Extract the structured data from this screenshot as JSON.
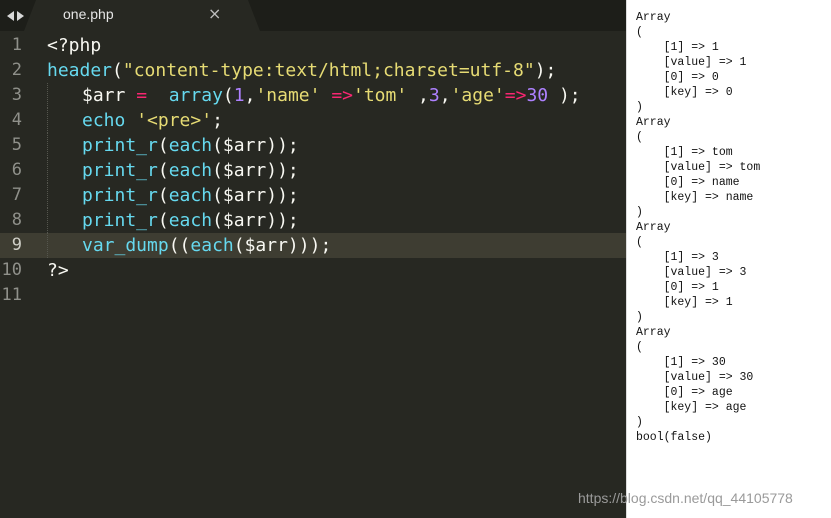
{
  "tab": {
    "title": "one.php",
    "close_glyph": "×"
  },
  "editor": {
    "line_numbers": [
      "1",
      "2",
      "3",
      "4",
      "5",
      "6",
      "7",
      "8",
      "9",
      "10",
      "11"
    ],
    "current_line": 9,
    "lines": [
      [
        {
          "t": "<?php",
          "c": "pl"
        }
      ],
      [
        {
          "t": "header",
          "c": "fn"
        },
        {
          "t": "(",
          "c": "pl"
        },
        {
          "t": "\"content-type:text/html;charset=utf-8\"",
          "c": "str"
        },
        {
          "t": ");",
          "c": "pl"
        }
      ],
      [
        {
          "t": "$arr ",
          "c": "pl"
        },
        {
          "t": "=",
          "c": "kw"
        },
        {
          "t": "  ",
          "c": "pl"
        },
        {
          "t": "array",
          "c": "fn"
        },
        {
          "t": "(",
          "c": "pl"
        },
        {
          "t": "1",
          "c": "num"
        },
        {
          "t": ",",
          "c": "pl"
        },
        {
          "t": "'name'",
          "c": "str"
        },
        {
          "t": " ",
          "c": "pl"
        },
        {
          "t": "=>",
          "c": "kw"
        },
        {
          "t": "'tom'",
          "c": "str"
        },
        {
          "t": " ,",
          "c": "pl"
        },
        {
          "t": "3",
          "c": "num"
        },
        {
          "t": ",",
          "c": "pl"
        },
        {
          "t": "'age'",
          "c": "str"
        },
        {
          "t": "=>",
          "c": "kw"
        },
        {
          "t": "30",
          "c": "num"
        },
        {
          "t": " );",
          "c": "pl"
        }
      ],
      [
        {
          "t": "echo",
          "c": "fn"
        },
        {
          "t": " ",
          "c": "pl"
        },
        {
          "t": "'<pre>'",
          "c": "str"
        },
        {
          "t": ";",
          "c": "pl"
        }
      ],
      [
        {
          "t": "print_r",
          "c": "fn"
        },
        {
          "t": "(",
          "c": "pl"
        },
        {
          "t": "each",
          "c": "fn"
        },
        {
          "t": "($arr));",
          "c": "pl"
        }
      ],
      [
        {
          "t": "print_r",
          "c": "fn"
        },
        {
          "t": "(",
          "c": "pl"
        },
        {
          "t": "each",
          "c": "fn"
        },
        {
          "t": "($arr));",
          "c": "pl"
        }
      ],
      [
        {
          "t": "print_r",
          "c": "fn"
        },
        {
          "t": "(",
          "c": "pl"
        },
        {
          "t": "each",
          "c": "fn"
        },
        {
          "t": "($arr));",
          "c": "pl"
        }
      ],
      [
        {
          "t": "print_r",
          "c": "fn"
        },
        {
          "t": "(",
          "c": "pl"
        },
        {
          "t": "each",
          "c": "fn"
        },
        {
          "t": "($arr));",
          "c": "pl"
        }
      ],
      [
        {
          "t": "var_dump",
          "c": "fn"
        },
        {
          "t": "((",
          "c": "pl"
        },
        {
          "t": "each",
          "c": "fn"
        },
        {
          "t": "($arr)));",
          "c": "pl"
        }
      ],
      [
        {
          "t": "?>",
          "c": "pl"
        }
      ],
      []
    ],
    "indented_lines": [
      3,
      4,
      5,
      6,
      7,
      8,
      9
    ]
  },
  "output": {
    "text": "Array\n(\n    [1] => 1\n    [value] => 1\n    [0] => 0\n    [key] => 0\n)\nArray\n(\n    [1] => tom\n    [value] => tom\n    [0] => name\n    [key] => name\n)\nArray\n(\n    [1] => 3\n    [value] => 3\n    [0] => 1\n    [key] => 1\n)\nArray\n(\n    [1] => 30\n    [value] => 30\n    [0] => age\n    [key] => age\n)\nbool(false)"
  },
  "watermark": "https://blog.csdn.net/qq_44105778",
  "icons": {
    "back": "nav-back-icon",
    "forward": "nav-forward-icon",
    "close": "close-icon"
  }
}
